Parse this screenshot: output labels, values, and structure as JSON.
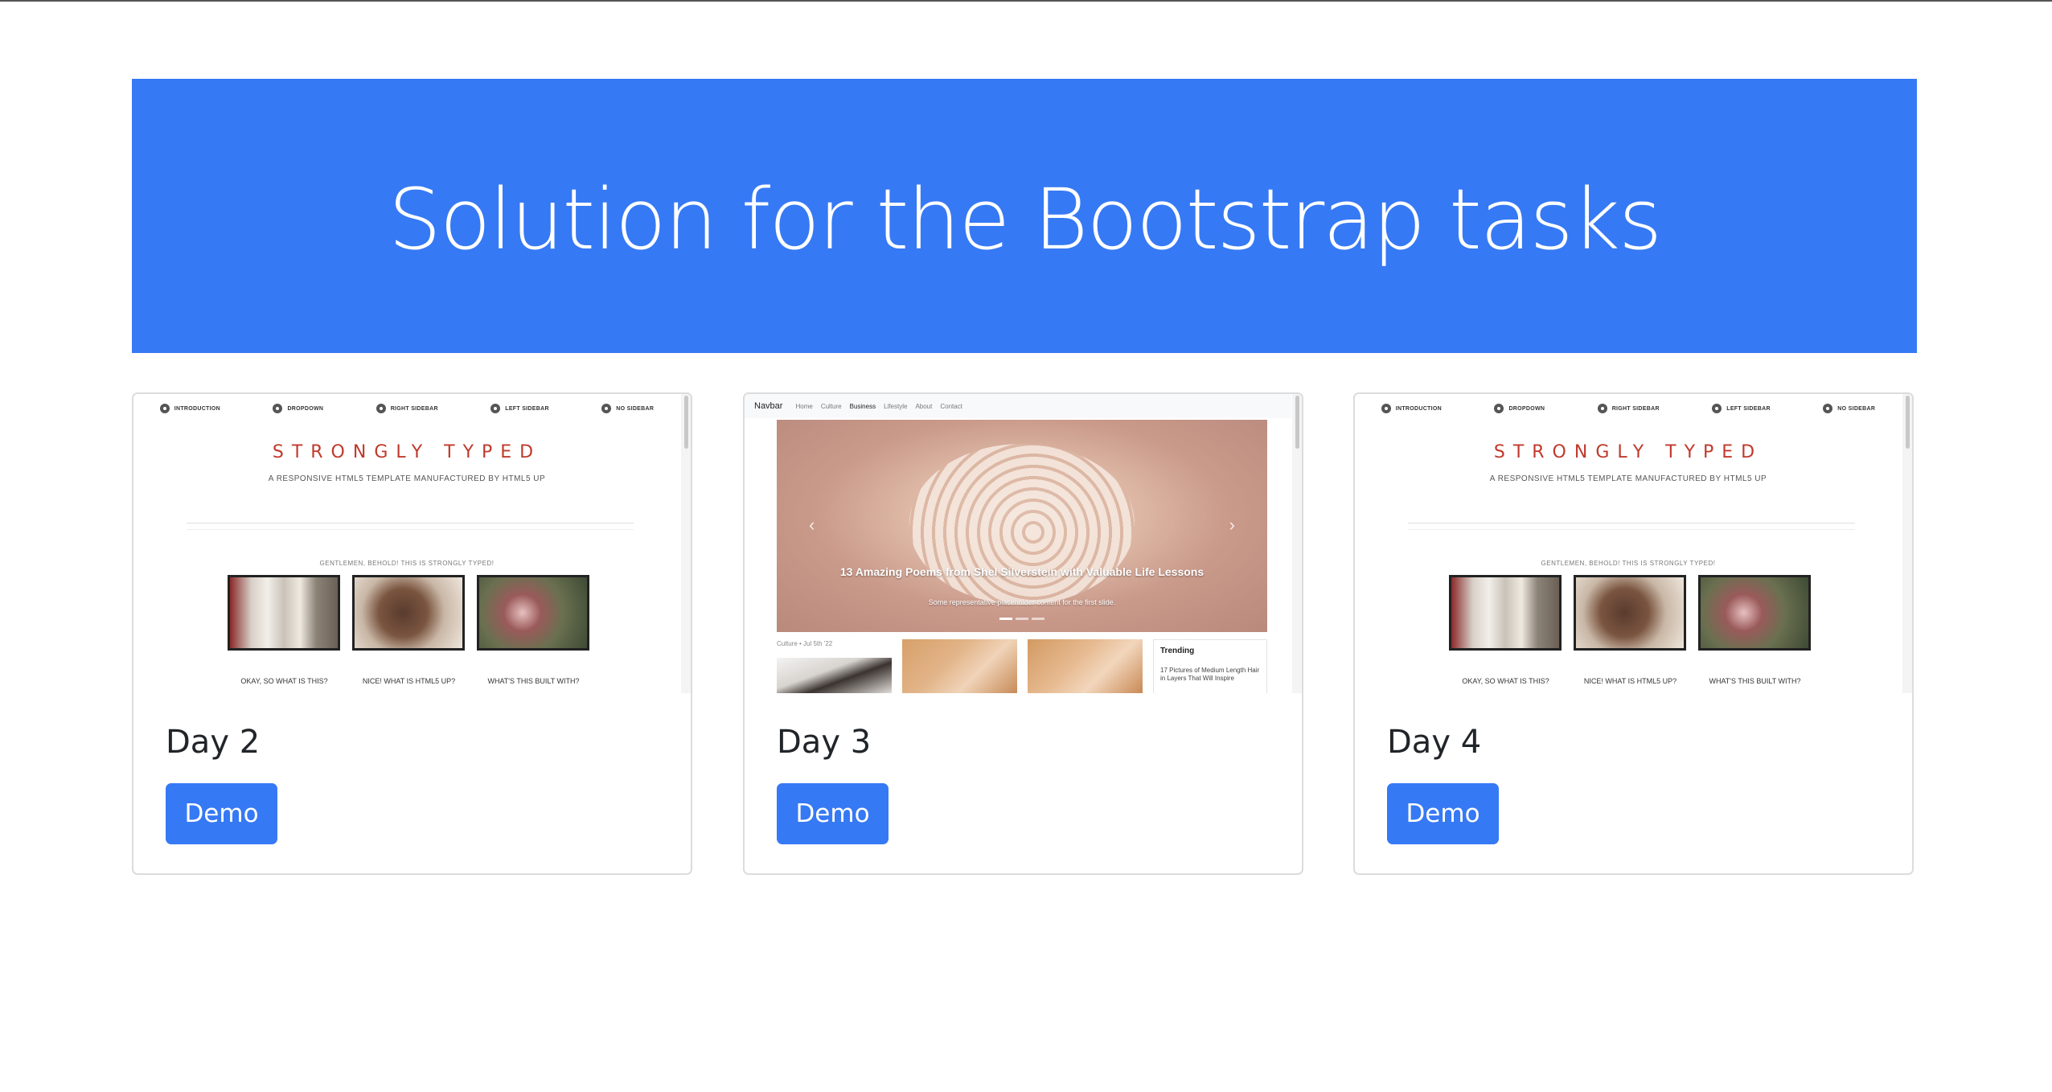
{
  "header": {
    "title": "Solution for the Bootstrap tasks"
  },
  "accent_color": "#3679f5",
  "cards": [
    {
      "title": "Day 2",
      "button_label": "Demo",
      "preview": {
        "nav": [
          "INTRODUCTION",
          "DROPDOWN",
          "RIGHT SIDEBAR",
          "LEFT SIDEBAR",
          "NO SIDEBAR"
        ],
        "brand": "STRONGLY TYPED",
        "tagline": "A RESPONSIVE HTML5 TEMPLATE MANUFACTURED BY HTML5 UP",
        "subheading": "GENTLEMEN, BEHOLD! THIS IS STRONGLY TYPED!",
        "captions": [
          "OKAY, SO WHAT IS THIS?",
          "NICE! WHAT IS HTML5 UP?",
          "WHAT'S THIS BUILT WITH?"
        ]
      }
    },
    {
      "title": "Day 3",
      "button_label": "Demo",
      "preview": {
        "brand": "Navbar",
        "links": [
          "Home",
          "Culture",
          "Business",
          "Lifestyle",
          "About",
          "Contact"
        ],
        "hero_caption": "13 Amazing Poems from Shel Silverstein with Valuable Life Lessons",
        "hero_sub": "Some representative placeholder content for the first slide.",
        "meta": "Culture • Jul 5th '22",
        "trending_title": "Trending",
        "trending_item": "17 Pictures of Medium Length Hair in Layers That Will Inspire"
      }
    },
    {
      "title": "Day 4",
      "button_label": "Demo",
      "preview": {
        "nav": [
          "INTRODUCTION",
          "DROPDOWN",
          "RIGHT SIDEBAR",
          "LEFT SIDEBAR",
          "NO SIDEBAR"
        ],
        "brand": "STRONGLY TYPED",
        "tagline": "A RESPONSIVE HTML5 TEMPLATE MANUFACTURED BY HTML5 UP",
        "subheading": "GENTLEMEN, BEHOLD! THIS IS STRONGLY TYPED!",
        "captions": [
          "OKAY, SO WHAT IS THIS?",
          "NICE! WHAT IS HTML5 UP?",
          "WHAT'S THIS BUILT WITH?"
        ]
      }
    }
  ]
}
